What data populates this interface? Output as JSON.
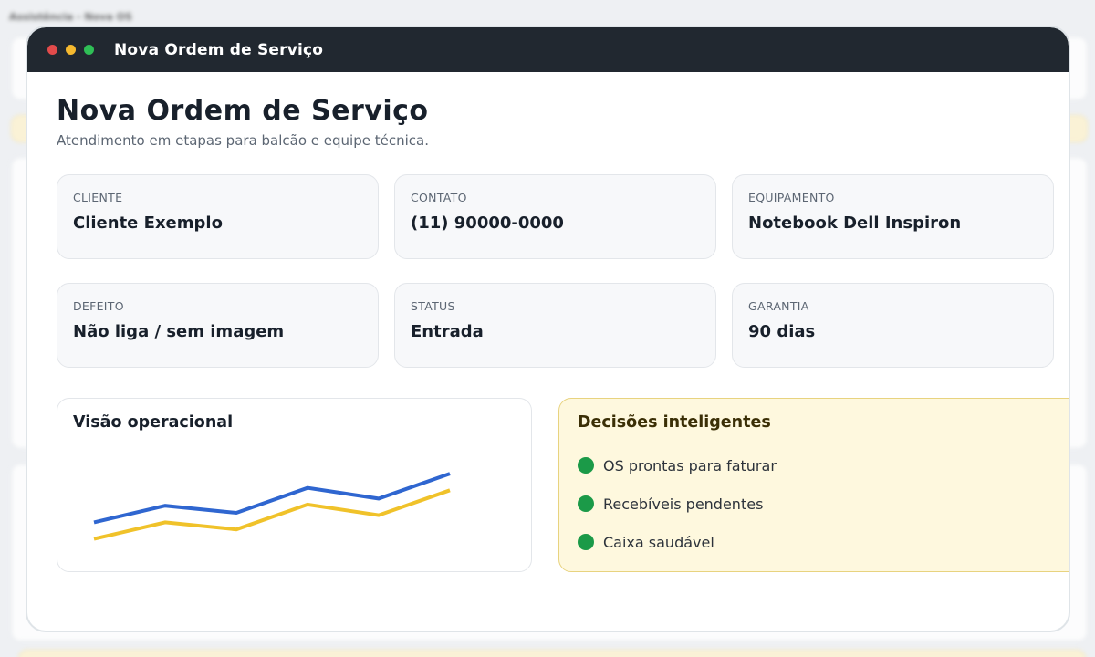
{
  "background": {
    "app_title": "Assistência - Nova OS"
  },
  "window": {
    "title": "Nova Ordem de Serviço"
  },
  "page": {
    "title": "Nova Ordem de Serviço",
    "subtitle": "Atendimento em etapas para balcão e equipe técnica."
  },
  "fields": [
    {
      "label": "CLIENTE",
      "value": "Cliente Exemplo"
    },
    {
      "label": "CONTATO",
      "value": "(11) 90000-0000"
    },
    {
      "label": "EQUIPAMENTO",
      "value": "Notebook Dell Inspiron"
    },
    {
      "label": "DEFEITO",
      "value": "Não liga / sem imagem"
    },
    {
      "label": "STATUS",
      "value": "Entrada"
    },
    {
      "label": "GARANTIA",
      "value": "90 dias"
    }
  ],
  "overview": {
    "title": "Visão operacional"
  },
  "decisions": {
    "title": "Decisões inteligentes",
    "items": [
      "OS prontas para faturar",
      "Recebíveis pendentes",
      "Caixa saudável"
    ],
    "bullet_color": "#1b9a48"
  },
  "chart_data": {
    "type": "line",
    "x": [
      1,
      2,
      3,
      4,
      5,
      6
    ],
    "series": [
      {
        "values": [
          42,
          56,
          50,
          71,
          62,
          83
        ],
        "color": "#2f66d0"
      },
      {
        "values": [
          28,
          42,
          36,
          57,
          48,
          69
        ],
        "color": "#f0c22a"
      }
    ],
    "ylim": [
      0,
      100
    ],
    "grid": false
  }
}
